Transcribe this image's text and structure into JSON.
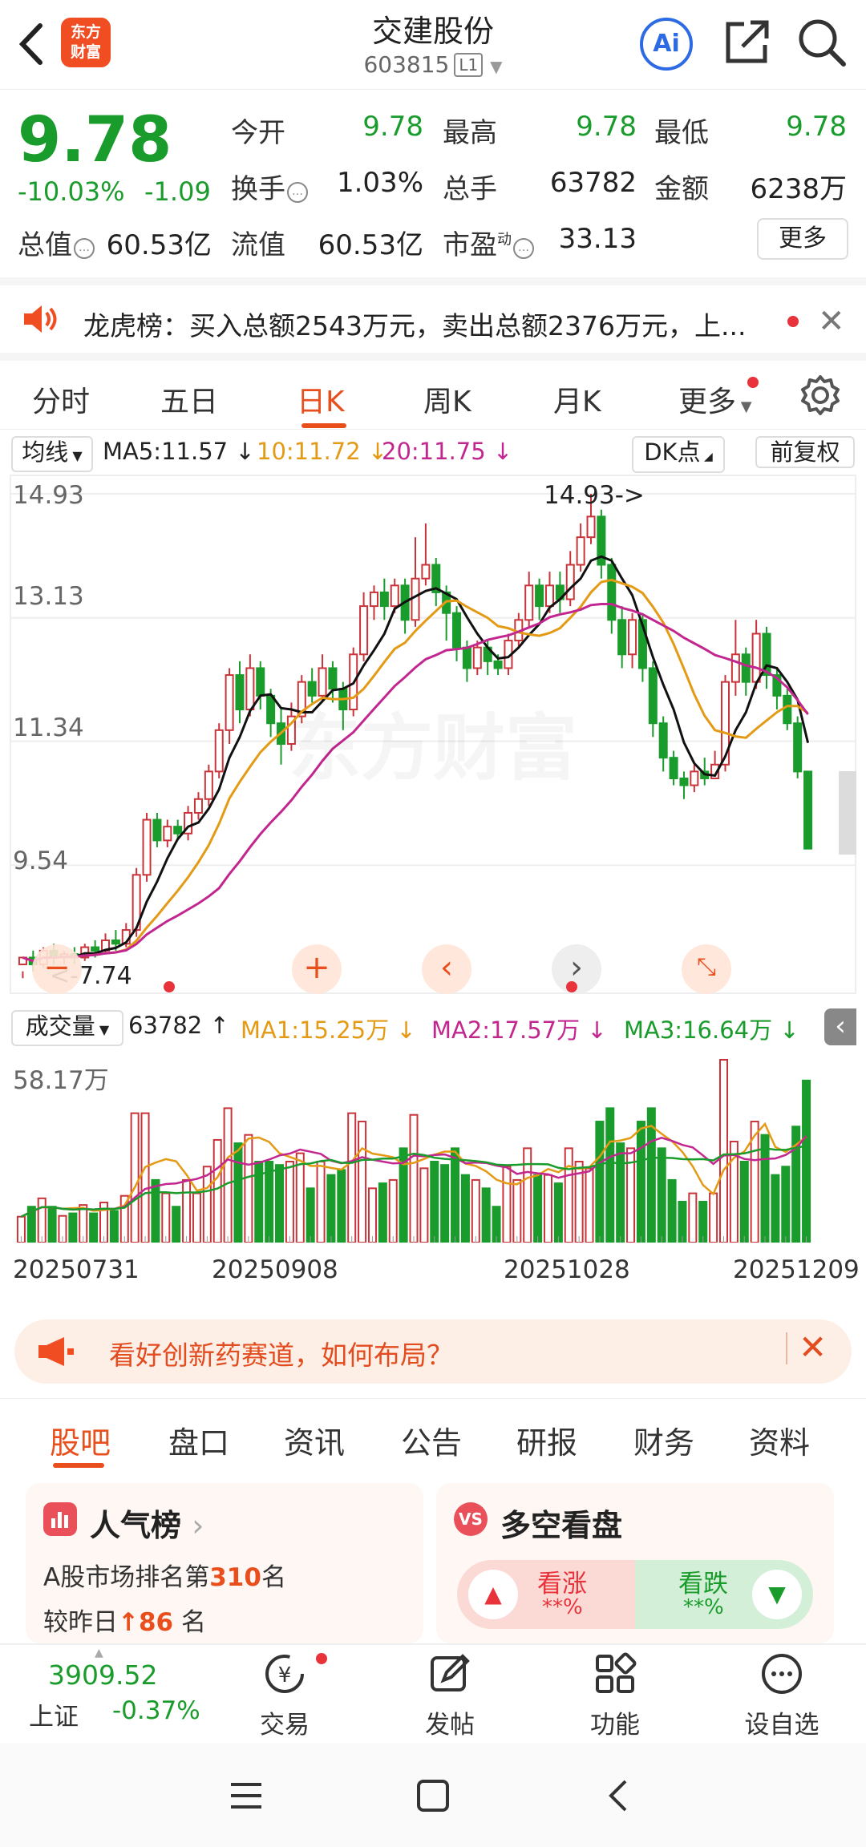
{
  "header": {
    "title": "交建股份",
    "code": "603815",
    "level": "L1",
    "logo_line1": "东方",
    "logo_line2": "财富",
    "ai": "Ai"
  },
  "quote": {
    "price": "9.78",
    "pct": "-10.03%",
    "change": "-1.09",
    "open_label": "今开",
    "open": "9.78",
    "high_label": "最高",
    "high": "9.78",
    "low_label": "最低",
    "low": "9.78",
    "turnover_label": "换手",
    "turnover": "1.03%",
    "volume_label": "总手",
    "volume": "63782",
    "amount_label": "金额",
    "amount": "6238万",
    "mktcap_label": "总值",
    "mktcap": "60.53亿",
    "float_label": "流值",
    "float_cap": "60.53亿",
    "pe_label": "市盈",
    "pe_sup": "动",
    "pe": "33.13",
    "more": "更多"
  },
  "notice": {
    "text": "龙虎榜：买入总额2543万元，卖出总额2376万元，上..."
  },
  "ktabs": [
    "分时",
    "五日",
    "日K",
    "周K",
    "月K",
    "更多"
  ],
  "ma": {
    "select": "均线",
    "ma5": "MA5:11.57",
    "ma10": "10:11.72",
    "ma20": "20:11.75",
    "dk": "DK点",
    "fq": "前复权"
  },
  "kaxis": {
    "y1": "14.93",
    "y2": "13.13",
    "y3": "11.34",
    "y4": "9.54",
    "max_label": "14.93->",
    "min_label": "<-7.74"
  },
  "vol": {
    "select": "成交量",
    "value": "63782",
    "ma1": "MA1:15.25万",
    "ma2": "MA2:17.57万",
    "ma3": "MA3:16.64万",
    "max": "58.17万"
  },
  "dates": [
    "20250731",
    "20250908",
    "20251028",
    "20251209"
  ],
  "watermark": "东方财富",
  "ad": {
    "text": "看好创新药赛道，如何布局？"
  },
  "btabs": [
    "股吧",
    "盘口",
    "资讯",
    "公告",
    "研报",
    "财务",
    "资料"
  ],
  "rank": {
    "title": "人气榜",
    "line1_pre": "A股市场排名第",
    "line1_num": "310",
    "line1_post": "名",
    "line2_pre": "较昨日",
    "line2_num": "86",
    "line2_post": "名"
  },
  "duokong": {
    "title": "多空看盘",
    "up": "看涨",
    "up_val": "**%",
    "down": "看跌",
    "down_val": "**%"
  },
  "nav": {
    "index_value": "3909.52",
    "index_name": "上证",
    "index_change": "-0.37%",
    "trade": "交易",
    "post": "发帖",
    "func": "功能",
    "fav": "设自选"
  },
  "colors": {
    "up": "#c8343a",
    "down": "#1a9c2c",
    "accent": "#e94f1d",
    "ma5": "#111111",
    "ma10": "#e39a14",
    "ma20": "#c2278f"
  },
  "chart_data": {
    "type": "candlestick",
    "ylim": [
      7.74,
      14.93
    ],
    "candles": [
      [
        8.1,
        8.2,
        8.0,
        7.9
      ],
      [
        8.2,
        8.1,
        8.3,
        8.0
      ],
      [
        8.1,
        8.3,
        8.35,
        8.05
      ],
      [
        8.3,
        8.2,
        8.4,
        8.1
      ],
      [
        8.2,
        8.25,
        8.3,
        8.1
      ],
      [
        8.25,
        8.2,
        8.35,
        8.1
      ],
      [
        8.2,
        8.35,
        8.4,
        8.15
      ],
      [
        8.35,
        8.3,
        8.45,
        8.2
      ],
      [
        8.3,
        8.45,
        8.55,
        8.25
      ],
      [
        8.45,
        8.4,
        8.6,
        8.3
      ],
      [
        8.4,
        8.6,
        8.7,
        8.35
      ],
      [
        8.6,
        9.4,
        9.5,
        8.5
      ],
      [
        9.4,
        10.2,
        10.3,
        9.3
      ],
      [
        10.2,
        9.9,
        10.3,
        9.8
      ],
      [
        9.9,
        10.1,
        10.2,
        9.8
      ],
      [
        10.1,
        10.0,
        10.2,
        9.9
      ],
      [
        10.0,
        10.3,
        10.4,
        9.9
      ],
      [
        10.3,
        10.5,
        10.6,
        10.2
      ],
      [
        10.5,
        10.9,
        11.0,
        10.4
      ],
      [
        10.9,
        11.5,
        11.6,
        10.8
      ],
      [
        11.5,
        12.3,
        12.4,
        11.3
      ],
      [
        12.3,
        11.8,
        12.5,
        11.6
      ],
      [
        11.8,
        12.4,
        12.6,
        11.7
      ],
      [
        12.4,
        12.0,
        12.5,
        11.8
      ],
      [
        12.0,
        11.6,
        12.1,
        11.4
      ],
      [
        11.6,
        11.3,
        11.8,
        11.0
      ],
      [
        11.3,
        11.7,
        11.9,
        11.2
      ],
      [
        11.7,
        12.2,
        12.3,
        11.6
      ],
      [
        12.2,
        12.0,
        12.4,
        11.9
      ],
      [
        12.0,
        12.4,
        12.6,
        11.9
      ],
      [
        12.4,
        12.1,
        12.5,
        11.9
      ],
      [
        12.1,
        11.8,
        12.2,
        11.5
      ],
      [
        11.8,
        12.6,
        12.7,
        11.7
      ],
      [
        12.6,
        13.3,
        13.5,
        12.5
      ],
      [
        13.3,
        13.5,
        13.6,
        13.1
      ],
      [
        13.5,
        13.3,
        13.7,
        13.1
      ],
      [
        13.3,
        13.6,
        13.7,
        13.2
      ],
      [
        13.6,
        13.1,
        13.7,
        12.9
      ],
      [
        13.1,
        13.7,
        14.3,
        13.0
      ],
      [
        13.7,
        13.9,
        14.5,
        13.6
      ],
      [
        13.9,
        13.5,
        14.0,
        13.3
      ],
      [
        13.5,
        13.2,
        13.6,
        12.8
      ],
      [
        13.2,
        12.7,
        13.3,
        12.5
      ],
      [
        12.7,
        12.4,
        12.8,
        12.2
      ],
      [
        12.4,
        12.7,
        12.8,
        12.3
      ],
      [
        12.7,
        12.5,
        12.8,
        12.3
      ],
      [
        12.5,
        12.4,
        12.6,
        12.3
      ],
      [
        12.4,
        12.8,
        12.9,
        12.3
      ],
      [
        12.8,
        13.1,
        13.2,
        12.7
      ],
      [
        13.1,
        13.6,
        13.8,
        13.0
      ],
      [
        13.6,
        13.3,
        13.7,
        13.1
      ],
      [
        13.3,
        13.6,
        13.8,
        13.2
      ],
      [
        13.6,
        13.4,
        13.8,
        13.2
      ],
      [
        13.4,
        13.9,
        14.1,
        13.3
      ],
      [
        13.9,
        14.3,
        14.5,
        13.8
      ],
      [
        14.3,
        14.6,
        14.93,
        14.2
      ],
      [
        14.6,
        13.9,
        14.7,
        13.7
      ],
      [
        13.9,
        13.1,
        14.0,
        12.9
      ],
      [
        13.1,
        12.6,
        13.3,
        12.4
      ],
      [
        12.6,
        13.1,
        13.2,
        12.4
      ],
      [
        13.1,
        12.4,
        13.2,
        12.2
      ],
      [
        12.4,
        11.6,
        12.5,
        11.4
      ],
      [
        11.6,
        11.1,
        11.7,
        10.9
      ],
      [
        11.1,
        10.8,
        11.2,
        10.7
      ],
      [
        10.8,
        10.7,
        10.9,
        10.5
      ],
      [
        10.7,
        10.9,
        11.0,
        10.6
      ],
      [
        10.9,
        10.8,
        11.1,
        10.7
      ],
      [
        10.8,
        11.0,
        11.2,
        10.8
      ],
      [
        11.0,
        12.2,
        12.3,
        10.9
      ],
      [
        12.2,
        12.6,
        13.1,
        12.0
      ],
      [
        12.6,
        12.2,
        12.7,
        12.0
      ],
      [
        12.2,
        12.9,
        13.1,
        12.1
      ],
      [
        12.9,
        12.3,
        13.0,
        12.1
      ],
      [
        12.3,
        12.0,
        12.4,
        11.8
      ],
      [
        12.0,
        11.6,
        12.1,
        11.5
      ],
      [
        11.6,
        10.9,
        11.7,
        10.8
      ],
      [
        10.9,
        9.78,
        10.9,
        9.78
      ]
    ]
  }
}
